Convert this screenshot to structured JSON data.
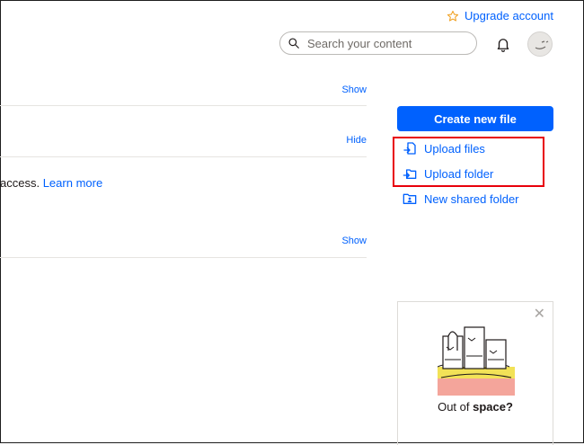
{
  "header": {
    "upgrade_label": "Upgrade account",
    "search_placeholder": "Search your content"
  },
  "sections": [
    {
      "toggle_label": "Show"
    },
    {
      "toggle_label": "Hide",
      "notice_text": "access.",
      "notice_link": "Learn more"
    },
    {
      "toggle_label": "Show"
    }
  ],
  "sidebar": {
    "create_label": "Create new file",
    "actions": [
      {
        "label": "Upload files",
        "icon": "upload-file-icon"
      },
      {
        "label": "Upload folder",
        "icon": "upload-folder-icon"
      },
      {
        "label": "New shared folder",
        "icon": "shared-folder-icon"
      }
    ]
  },
  "promo": {
    "caption_prefix": "Out of ",
    "caption_bold": "space?",
    "close_icon": "close-icon"
  },
  "colors": {
    "accent": "#0061fe",
    "highlight_box": "#e8000b"
  }
}
